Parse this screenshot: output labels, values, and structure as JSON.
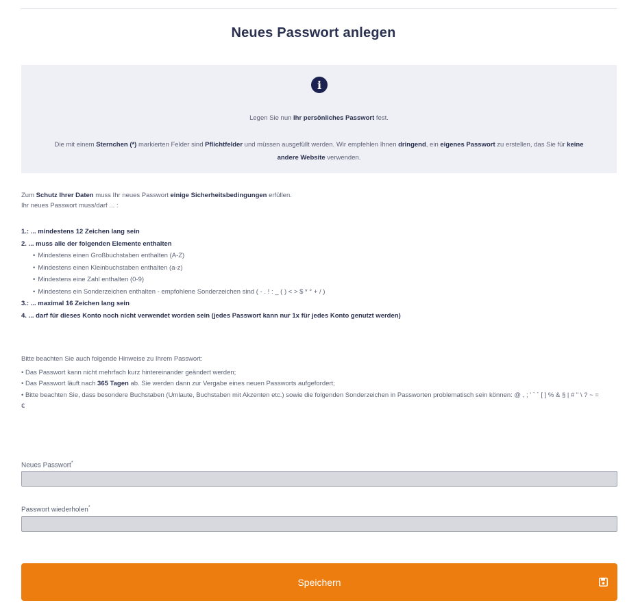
{
  "page": {
    "title": "Neues Passwort anlegen"
  },
  "info_box": {
    "icon": "info-icon",
    "line1": {
      "before": "Legen Sie nun ",
      "bold": "Ihr persönliches Passwort",
      "after": " fest."
    },
    "line2": {
      "t1": "Die mit einem ",
      "b1": "Sternchen (*)",
      "t2": " markierten Felder sind ",
      "b2": "Pflichtfelder",
      "t3": " und müssen ausgefüllt werden. Wir empfehlen Ihnen ",
      "b3": "dringend",
      "t4": ", ein ",
      "b4": "eigenes Passwort",
      "t5": " zu erstellen, das Sie für ",
      "b5": "keine andere Website",
      "t6": " verwenden."
    }
  },
  "intro": {
    "t1": "Zum ",
    "b1": "Schutz Ihrer Daten",
    "t2": " muss Ihr neues Passwort ",
    "b2": "einige Sicherheitsbedingungen",
    "t3": " erfüllen.",
    "line2": "Ihr neues Passwort muss/darf ... :"
  },
  "rules": {
    "r1": "1.: ... mindestens 12 Zeichen lang sein",
    "r2": "2. ... muss alle der folgenden Elemente enthalten",
    "sub": [
      "Mindestens einen Großbuchstaben enthalten (A-Z)",
      "Mindestens einen Kleinbuchstaben enthalten (a-z)",
      "Mindestens eine Zahl enthalten (0-9)",
      "Mindestens ein Sonderzeichen enthalten - empfohlene Sonderzeichen sind ( - . ! : _ ( ) < > $ * ° + / )"
    ],
    "r3": "3.: ... maximal 16 Zeichen lang sein",
    "r4": "4. ... darf für dieses Konto noch nicht verwendet worden sein (jedes Passwort kann nur 1x für jedes Konto genutzt werden)"
  },
  "hints": {
    "heading": "Bitte beachten Sie auch folgende Hinweise zu Ihrem Passwort:",
    "h1": "• Das Passwort kann nicht mehrfach kurz hintereinander geändert werden;",
    "h2_before": "• Das Passwort läuft nach ",
    "h2_bold": "365 Tagen",
    "h2_after": " ab. Sie werden dann zur Vergabe eines neuen Passworts aufgefordert;",
    "h3": "• Bitte beachten Sie, dass besondere Buchstaben (Umlaute, Buchstaben mit Akzenten etc.) sowie die folgenden Sonderzeichen in Passworten problematisch sein können: @ , ; ' ` ´ [ ] % & § | # \" \\ ? ~ = €"
  },
  "form": {
    "new_password": {
      "label": "Neues Passwort",
      "required_mark": "*",
      "value": ""
    },
    "repeat_password": {
      "label": "Passwort wiederholen",
      "required_mark": "*",
      "value": ""
    }
  },
  "save_button": {
    "label": "Speichern",
    "icon": "save-icon",
    "color": "#ed7d0e"
  }
}
